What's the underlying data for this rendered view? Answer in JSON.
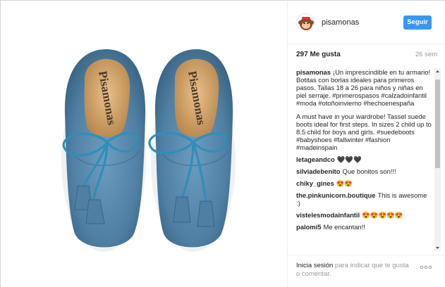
{
  "post": {
    "username": "pisamonas",
    "follow_label": "Seguir",
    "likes": "297 Me gusta",
    "age": "26 sem",
    "image_alt": "Botitas azules con borlas Pisamonas"
  },
  "comments": [
    {
      "user": "pisamonas",
      "text": "¡Un imprescindible en tu armario! Botitas con borlas ideales para primeros pasos. Tallas 18 a 26 para niños y niñas en piel serraje. #primerospasos #calzadoinfantil #moda #otoñoinvierno #hechoenespaña"
    },
    {
      "user": "",
      "text": "A must have in your wardrobe! Tassel suede boots ideal for first steps. In sizes 2 child up to 8.5 child for boys and girls. #suedeboots #babyshoes #fallwinter #fashion #madeinspain"
    },
    {
      "user": "letageandco",
      "text": "🖤🖤🖤"
    },
    {
      "user": "silviadebenito",
      "text": "Que bonitos son!!!"
    },
    {
      "user": "chiky_gines",
      "text": "😍😍"
    },
    {
      "user": "the.pinkunicorn.boutique",
      "text": "This is awesome :)"
    },
    {
      "user": "vistelesmodainfantil",
      "text": "😍😍😍😍😍"
    },
    {
      "user": "palomi5",
      "text": "Me encantan!!"
    }
  ],
  "footer": {
    "login_link": "Inicia sesión",
    "login_rest": " para indicar que te gusta o comentar."
  },
  "shoe": {
    "brand_label": "Pisamonas"
  },
  "colors": {
    "accent": "#3897f0",
    "suede": "#4f7fa3",
    "lace": "#2f8fb8",
    "lining": "#d9a86c"
  }
}
